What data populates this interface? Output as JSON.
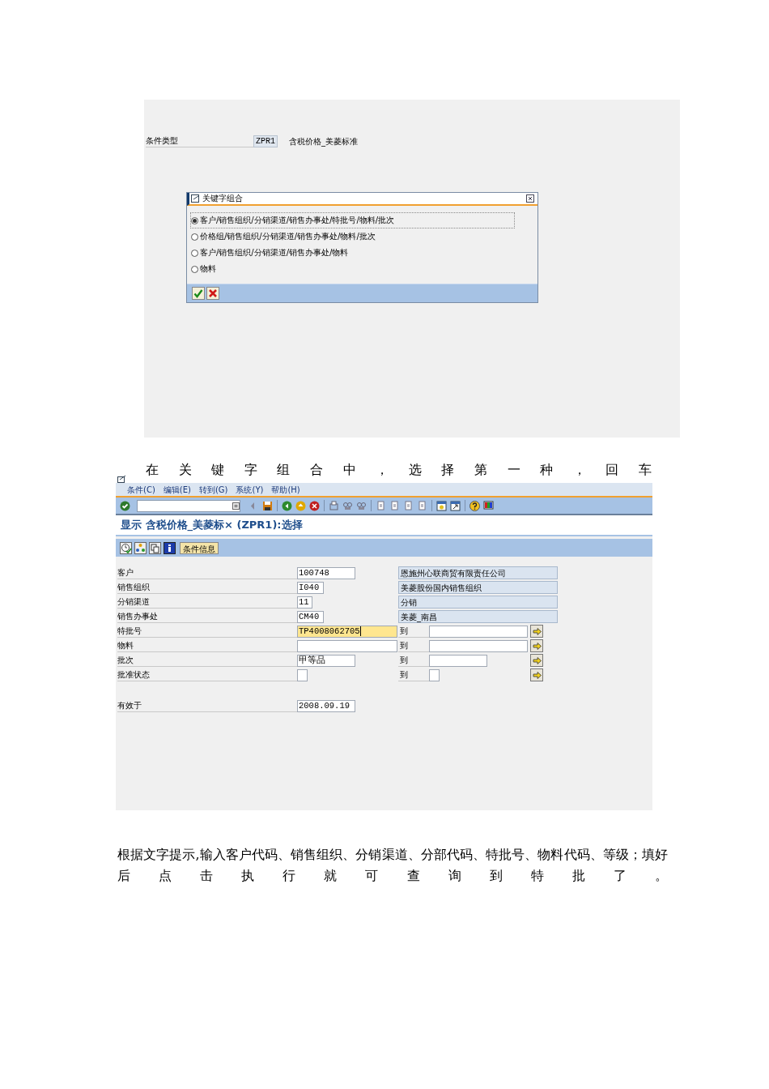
{
  "screenshot_1": {
    "condition_type": {
      "label": "条件类型",
      "value": "ZPR1",
      "description": "含税价格_美菱标准"
    },
    "dialog": {
      "title": "关键字组合",
      "options": [
        {
          "label": "客户/销售组织/分销渠道/销售办事处/特批号/物料/批次",
          "selected": true
        },
        {
          "label": "价格组/销售组织/分销渠道/销售办事处/物料/批次",
          "selected": false
        },
        {
          "label": "客户/销售组织/分销渠道/销售办事处/物料",
          "selected": false
        },
        {
          "label": "物料",
          "selected": false
        }
      ]
    }
  },
  "instruction_1": "在关键字组合中，选择第一种，回车",
  "screenshot_2": {
    "menu": [
      "条件(C)",
      "编辑(E)",
      "转到(G)",
      "系统(Y)",
      "帮助(H)"
    ],
    "title": "显示 含税价格_美菱标× (ZPR1):选择",
    "toolbar_button": "条件信息",
    "fields": [
      {
        "kind": "described",
        "label": "客户",
        "value": "100748",
        "focused": false,
        "description": "恩施州心联商贸有限责任公司"
      },
      {
        "kind": "described",
        "label": "销售组织",
        "value": "I040",
        "focused": false,
        "description": "美菱股份国内销售组织"
      },
      {
        "kind": "described",
        "label": "分销渠道",
        "value": "11",
        "focused": false,
        "description": "分销"
      },
      {
        "kind": "described",
        "label": "销售办事处",
        "value": "CM40",
        "focused": false,
        "description": "美菱_南昌"
      },
      {
        "kind": "range",
        "label": "特批号",
        "value": "TP4008062705",
        "focused": true,
        "to_label": "到"
      },
      {
        "kind": "range",
        "label": "物料",
        "focused": false,
        "to_label": "到"
      },
      {
        "kind": "range",
        "label": "批次",
        "value": "甲等品",
        "focused": false,
        "to_label": "到"
      },
      {
        "kind": "range",
        "label": "批准状态",
        "focused": false,
        "to_label": "到"
      }
    ],
    "valid_from": {
      "label": "有效于",
      "value": "2008.09.19"
    }
  },
  "instruction_2": "根据文字提示,输入客户代码、销售组织、分销渠道、分部代码、特批号、物料代码、等级；填好后点击执行就可查询到特批了。"
}
